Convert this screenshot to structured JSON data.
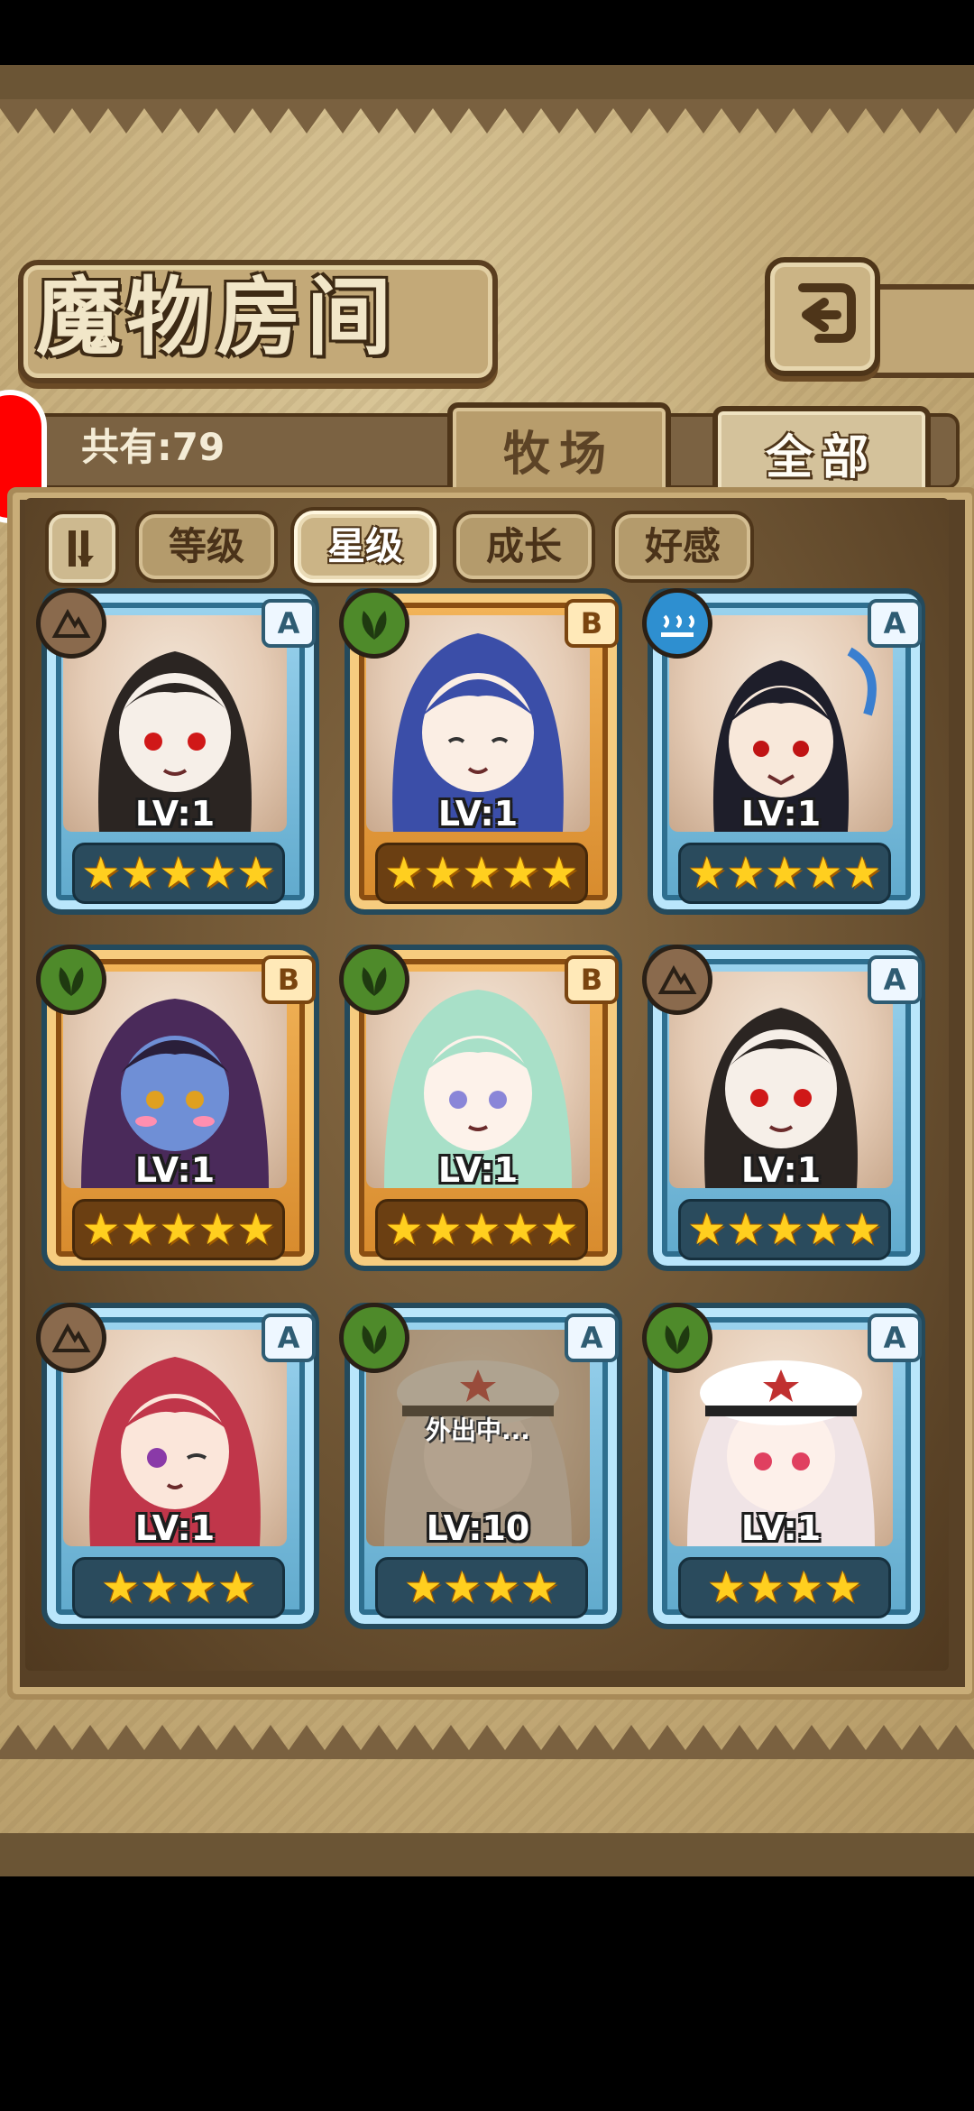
{
  "screen": {
    "title": "魔物房间",
    "count_label": "共有:79"
  },
  "tabs": [
    {
      "label": "牧场",
      "active": false
    },
    {
      "label": "全部",
      "active": true
    }
  ],
  "filters": [
    {
      "label": "等级",
      "active": false
    },
    {
      "label": "星级",
      "active": true
    },
    {
      "label": "成长",
      "active": false
    },
    {
      "label": "好感",
      "active": false
    }
  ],
  "icons": {
    "back": "return-arrow-icon",
    "sort": "sort-toggle-icon",
    "elements": {
      "earth": "earth-element-icon",
      "nature": "leaf-element-icon",
      "water": "water-element-icon"
    },
    "star": "star-icon"
  },
  "cards": [
    {
      "element": "earth",
      "rank": "A",
      "level": "LV:1",
      "stars": 5,
      "stars_text": "★★★★★",
      "away": false
    },
    {
      "element": "nature",
      "rank": "B",
      "level": "LV:1",
      "stars": 5,
      "stars_text": "★★★★★",
      "away": false
    },
    {
      "element": "water",
      "rank": "A",
      "level": "LV:1",
      "stars": 5,
      "stars_text": "★★★★★",
      "away": false
    },
    {
      "element": "nature",
      "rank": "B",
      "level": "LV:1",
      "stars": 5,
      "stars_text": "★★★★★",
      "away": false
    },
    {
      "element": "nature",
      "rank": "B",
      "level": "LV:1",
      "stars": 5,
      "stars_text": "★★★★★",
      "away": false
    },
    {
      "element": "earth",
      "rank": "A",
      "level": "LV:1",
      "stars": 5,
      "stars_text": "★★★★★",
      "away": false
    },
    {
      "element": "earth",
      "rank": "A",
      "level": "LV:1",
      "stars": 4,
      "stars_text": "★★★★",
      "away": false
    },
    {
      "element": "nature",
      "rank": "A",
      "level": "LV:10",
      "stars": 4,
      "stars_text": "★★★★",
      "away": true,
      "away_text": "外出中..."
    },
    {
      "element": "nature",
      "rank": "A",
      "level": "LV:1",
      "stars": 4,
      "stars_text": "★★★★",
      "away": false
    }
  ],
  "colors": {
    "rank_A_frame": "#5fa9cc",
    "rank_B_frame": "#d78a2c",
    "star": "#ffcf1f",
    "badge_earth": "#8a6a4d",
    "badge_nature": "#4e8a2a",
    "badge_water": "#2e8fd0",
    "notification": "#ff0000"
  }
}
